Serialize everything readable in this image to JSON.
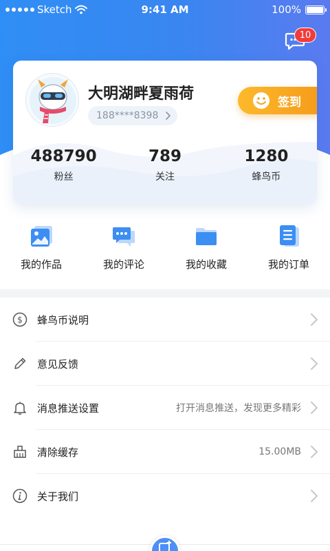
{
  "status_bar": {
    "carrier": "Sketch",
    "time": "9:41 AM",
    "battery": "100%",
    "battery_level": 1.0
  },
  "messages": {
    "badge_count": "10",
    "icon": "chat-bubble-icon"
  },
  "profile": {
    "username": "大明湖畔夏雨荷",
    "phone": "188****8398",
    "checkin_label": "签到",
    "stats": [
      {
        "value": "488790",
        "label": "粉丝"
      },
      {
        "value": "789",
        "label": "关注"
      },
      {
        "value": "1280",
        "label": "蜂鸟币"
      }
    ]
  },
  "quick_actions": [
    {
      "label": "我的作品",
      "icon": "image-icon"
    },
    {
      "label": "我的评论",
      "icon": "comment-icon"
    },
    {
      "label": "我的收藏",
      "icon": "folder-icon"
    },
    {
      "label": "我的订单",
      "icon": "document-icon"
    }
  ],
  "menu": [
    {
      "label": "蜂鸟币说明",
      "value": "",
      "icon": "coin-icon"
    },
    {
      "label": "意见反馈",
      "value": "",
      "icon": "pencil-icon"
    },
    {
      "label": "消息推送设置",
      "value": "打开消息推送，发现更多精彩",
      "icon": "bell-icon"
    },
    {
      "label": "清除缓存",
      "value": "15.00MB",
      "icon": "broom-icon"
    },
    {
      "label": "关于我们",
      "value": "",
      "icon": "info-icon"
    }
  ],
  "colors": {
    "primary": "#3a86f0",
    "accent": "#f59c1b",
    "badge": "#f23b3b"
  }
}
